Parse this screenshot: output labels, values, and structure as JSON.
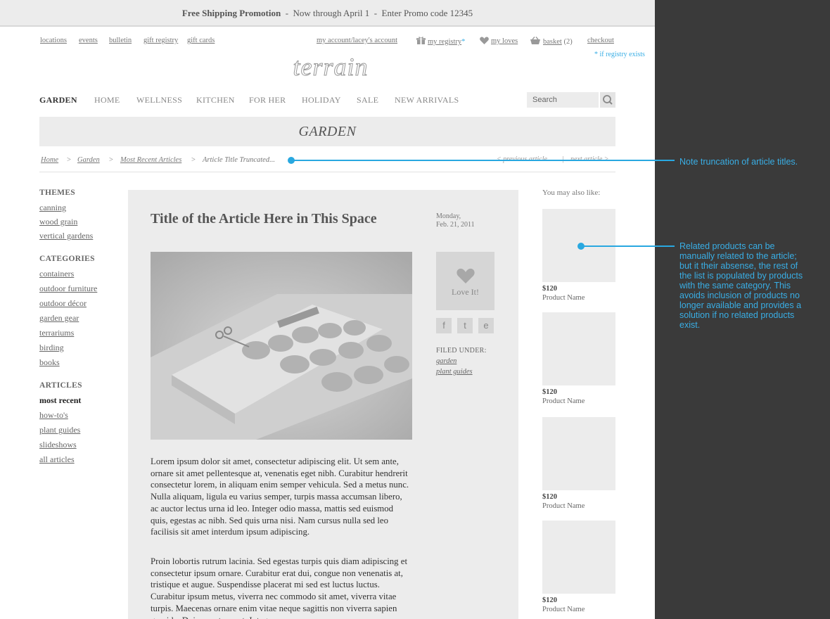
{
  "promo": {
    "title": "Free Shipping Promotion",
    "detail": "  -  Now through April 1  -  Enter Promo code 12345"
  },
  "utility_nav": {
    "locations": "locations",
    "events": "events",
    "bulletin": "bulletin",
    "gift_registry": "gift registry",
    "gift_cards": "gift cards",
    "account": "my account/lacey's account",
    "registry": "my registry",
    "registry_star": "*",
    "loves": "my loves",
    "basket": "basket",
    "basket_count": "(2)",
    "checkout": "checkout",
    "registry_note": "* if registry exists"
  },
  "logo": "terrain",
  "main_nav": [
    "GARDEN",
    "HOME",
    "WELLNESS",
    "KITCHEN",
    "FOR HER",
    "HOLIDAY",
    "SALE",
    "NEW ARRIVALS"
  ],
  "search": {
    "placeholder": "Search"
  },
  "page_title": "GARDEN",
  "breadcrumb": {
    "home": "Home",
    "garden": "Garden",
    "recent": "Most Recent Articles",
    "current": "Article Title Truncated...",
    "sep": ">",
    "previous": "<  previous article",
    "divider": "|",
    "next": "next article  >"
  },
  "sidebar": {
    "themes_heading": "THEMES",
    "themes": [
      "canning",
      "wood grain",
      "vertical gardens"
    ],
    "categories_heading": "CATEGORIES",
    "categories": [
      "containers",
      "outdoor furniture",
      "outdoor décor",
      "garden gear",
      "terrariums",
      "birding",
      "books"
    ],
    "articles_heading": "ARTICLES",
    "articles": [
      "most recent",
      "how-to's",
      "plant guides",
      "slideshows",
      "all articles"
    ]
  },
  "article": {
    "title": "Title of the Article Here in This Space",
    "date_line1": "Monday,",
    "date_line2": "Feb. 21, 2011",
    "love_label": "Love It!",
    "share": [
      "f",
      "t",
      "e"
    ],
    "filed_under_label": "FILED UNDER:",
    "filed_under": [
      "garden",
      "plant guides"
    ],
    "paragraph1": "Lorem ipsum dolor sit amet, consectetur adipiscing elit. Ut sem ante, ornare sit amet pellentesque at, venenatis eget nibh. Curabitur hendrerit consectetur lorem, in aliquam enim semper vehicula. Sed a metus nunc. Nulla aliquam, ligula eu varius semper, turpis massa accumsan libero, ac auctor lectus urna id leo. Integer odio massa, mattis sed euismod quis, egestas ac nibh. Sed quis urna nisi. Nam cursus nulla sed leo facilisis sit amet interdum ipsum adipiscing.",
    "paragraph2": "Proin lobortis rutrum lacinia. Sed egestas turpis quis diam adipiscing et consectetur ipsum ornare. Curabitur erat dui, congue non venenatis at, tristique et augue. Suspendisse placerat mi sed est luctus luctus. Curabitur ipsum metus, viverra nec commodo sit amet, viverra vitae turpis. Maecenas ornare enim vitae neque sagittis non viverra sapien gravida. Duis a metus erat. Integer"
  },
  "related": {
    "heading": "You may also like:",
    "products": [
      {
        "price": "$120",
        "name": "Product Name"
      },
      {
        "price": "$120",
        "name": "Product Name"
      },
      {
        "price": "$120",
        "name": "Product Name"
      },
      {
        "price": "$120",
        "name": "Product Name"
      }
    ]
  },
  "annotations": {
    "truncation": "Note truncation of article titles.",
    "related": "Related products can be manually related to the article; but it their absense, the rest of the list is populated by products with the same category. This avoids inclusion of products no longer available and provides a solution if no related products exist."
  },
  "colors": {
    "annotation_accent": "#29a8e0",
    "annotation_panel": "#3a3a3a",
    "panel_gray": "#ececec"
  },
  "icons": [
    "gift-icon",
    "heart-icon",
    "basket-icon",
    "search-icon",
    "love-heart-icon",
    "facebook-icon",
    "twitter-icon",
    "email-icon"
  ]
}
